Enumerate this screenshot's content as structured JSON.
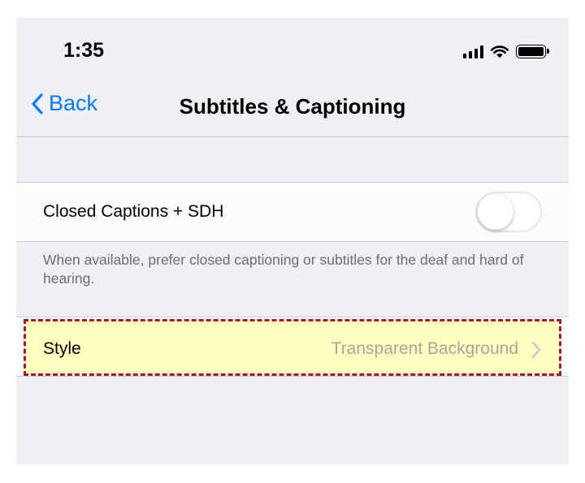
{
  "status_bar": {
    "time": "1:35",
    "icons": [
      "cellular-signal-icon",
      "wifi-icon",
      "battery-icon"
    ]
  },
  "nav": {
    "back_label": "Back",
    "title": "Subtitles & Captioning"
  },
  "closed_captions": {
    "label": "Closed Captions + SDH",
    "enabled": false,
    "footer": "When available, prefer closed captioning or subtitles for the deaf and hard of hearing."
  },
  "style_row": {
    "label": "Style",
    "value": "Transparent Background"
  },
  "colors": {
    "accent": "#007aff",
    "background": "#efeff4",
    "highlight_fill": "#ffffbf",
    "highlight_border": "#a4153f"
  }
}
